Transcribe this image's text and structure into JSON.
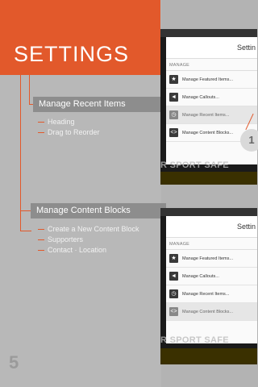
{
  "header": {
    "title": "SETTINGS"
  },
  "sections": [
    {
      "label": "Manage Recent Items",
      "items": [
        "Heading",
        "Drag to Reorder"
      ]
    },
    {
      "label": "Manage Content Blocks",
      "items": [
        "Create a New Content Block",
        "Supporters",
        "Contact · Location"
      ]
    }
  ],
  "page_number": "5",
  "screens": [
    {
      "title": "Settin",
      "subtitle": "MANAGE",
      "items": [
        {
          "label": "Manage Featured Items...",
          "icon": "star-icon",
          "glyph": "★",
          "active": false
        },
        {
          "label": "Manage Callouts...",
          "icon": "megaphone-icon",
          "glyph": "◄",
          "active": false
        },
        {
          "label": "Manage Recent Items...",
          "icon": "clock-icon",
          "glyph": "◷",
          "active": true
        },
        {
          "label": "Manage Content Blocks...",
          "icon": "code-icon",
          "glyph": "<>",
          "active": false
        }
      ],
      "background_text": "R SPORT SAFE",
      "badge": "1"
    },
    {
      "title": "Settin",
      "subtitle": "MANAGE",
      "items": [
        {
          "label": "Manage Featured Items...",
          "icon": "star-icon",
          "glyph": "★",
          "active": false
        },
        {
          "label": "Manage Callouts...",
          "icon": "megaphone-icon",
          "glyph": "◄",
          "active": false
        },
        {
          "label": "Manage Recent Items...",
          "icon": "clock-icon",
          "glyph": "◷",
          "active": false
        },
        {
          "label": "Manage Content Blocks...",
          "icon": "code-icon",
          "glyph": "<>",
          "active": true
        }
      ],
      "background_text": "R SPORT SAFE"
    }
  ],
  "colors": {
    "accent": "#e2592b",
    "background": "#b3b3b3",
    "section_bar": "#8d8d8d"
  }
}
